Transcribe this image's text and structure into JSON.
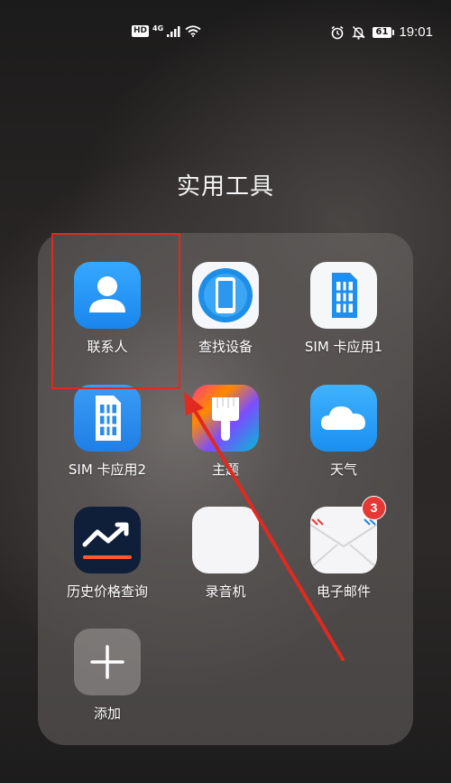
{
  "status_bar": {
    "hd": "HD",
    "network": "4G",
    "battery": "61",
    "time": "19:01"
  },
  "folder": {
    "title": "实用工具",
    "apps": [
      {
        "label": "联系人",
        "icon": "contacts-icon"
      },
      {
        "label": "查找设备",
        "icon": "find-device-icon"
      },
      {
        "label": "SIM 卡应用1",
        "icon": "sim-card-icon"
      },
      {
        "label": "SIM 卡应用2",
        "icon": "sim-card-icon"
      },
      {
        "label": "主题",
        "icon": "theme-brush-icon"
      },
      {
        "label": "天气",
        "icon": "weather-cloud-icon"
      },
      {
        "label": "历史价格查询",
        "icon": "price-trend-icon"
      },
      {
        "label": "录音机",
        "icon": "recorder-waveform-icon"
      },
      {
        "label": "电子邮件",
        "icon": "email-envelope-icon",
        "badge": "3"
      },
      {
        "label": "添加",
        "icon": "add-plus-icon"
      }
    ]
  },
  "colors": {
    "highlight": "#e02a1f",
    "contacts_blue": "#2196f3",
    "badge_red": "#e53935"
  }
}
